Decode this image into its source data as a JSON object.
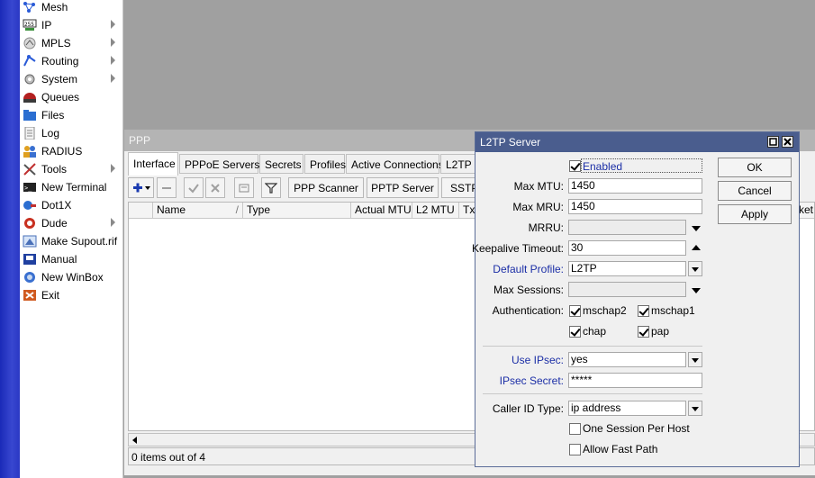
{
  "sidebar": {
    "items": [
      {
        "label": "Mesh",
        "icon": "mesh-icon",
        "submenu": false
      },
      {
        "label": "IP",
        "icon": "ip-icon",
        "submenu": true
      },
      {
        "label": "MPLS",
        "icon": "mpls-icon",
        "submenu": true
      },
      {
        "label": "Routing",
        "icon": "routing-icon",
        "submenu": true
      },
      {
        "label": "System",
        "icon": "system-icon",
        "submenu": true
      },
      {
        "label": "Queues",
        "icon": "queues-icon",
        "submenu": false
      },
      {
        "label": "Files",
        "icon": "files-icon",
        "submenu": false
      },
      {
        "label": "Log",
        "icon": "log-icon",
        "submenu": false
      },
      {
        "label": "RADIUS",
        "icon": "radius-icon",
        "submenu": false
      },
      {
        "label": "Tools",
        "icon": "tools-icon",
        "submenu": true
      },
      {
        "label": "New Terminal",
        "icon": "terminal-icon",
        "submenu": false
      },
      {
        "label": "Dot1X",
        "icon": "dot1x-icon",
        "submenu": false
      },
      {
        "label": "Dude",
        "icon": "dude-icon",
        "submenu": true
      },
      {
        "label": "Make Supout.rif",
        "icon": "supout-icon",
        "submenu": false
      },
      {
        "label": "Manual",
        "icon": "manual-icon",
        "submenu": false
      },
      {
        "label": "New WinBox",
        "icon": "winbox-icon",
        "submenu": false
      },
      {
        "label": "Exit",
        "icon": "exit-icon",
        "submenu": false
      }
    ]
  },
  "ppp": {
    "title": "PPP",
    "tabs": [
      "Interface",
      "PPPoE Servers",
      "Secrets",
      "Profiles",
      "Active Connections",
      "L2TP"
    ],
    "active_tab": "Interface",
    "toolbar": {
      "ppp_scanner": "PPP Scanner",
      "pptp_server": "PPTP Server",
      "sstp_server": "SSTP"
    },
    "columns": [
      "Name",
      "Type",
      "Actual MTU",
      "L2 MTU",
      "Tx"
    ],
    "column_right_fragment": "ket",
    "status": "0 items out of 4"
  },
  "l2tp": {
    "title": "L2TP Server",
    "enabled_label": "Enabled",
    "enabled": true,
    "max_mtu_label": "Max MTU:",
    "max_mtu": "1450",
    "max_mru_label": "Max MRU:",
    "max_mru": "1450",
    "mrru_label": "MRRU:",
    "mrru": "",
    "keepalive_label": "Keepalive Timeout:",
    "keepalive": "30",
    "default_profile_label": "Default Profile:",
    "default_profile": "L2TP",
    "max_sessions_label": "Max Sessions:",
    "max_sessions": "",
    "auth_label": "Authentication:",
    "auth": {
      "mschap2": {
        "label": "mschap2",
        "checked": true
      },
      "mschap1": {
        "label": "mschap1",
        "checked": true
      },
      "chap": {
        "label": "chap",
        "checked": true
      },
      "pap": {
        "label": "pap",
        "checked": true
      }
    },
    "use_ipsec_label": "Use IPsec:",
    "use_ipsec": "yes",
    "ipsec_secret_label": "IPsec Secret:",
    "ipsec_secret": "*****",
    "caller_id_label": "Caller ID Type:",
    "caller_id": "ip address",
    "one_session_label": "One Session Per Host",
    "one_session": false,
    "allow_fast_path_label": "Allow Fast Path",
    "allow_fast_path": false,
    "buttons": {
      "ok": "OK",
      "cancel": "Cancel",
      "apply": "Apply"
    }
  },
  "colors": {
    "brand_strip": "#2a38c4",
    "dialog_titlebar": "#4a5d8e",
    "ppp_titlebar": "#b4b4b4",
    "label_blue": "#1b2ea6",
    "background": "#a0a0a0"
  }
}
